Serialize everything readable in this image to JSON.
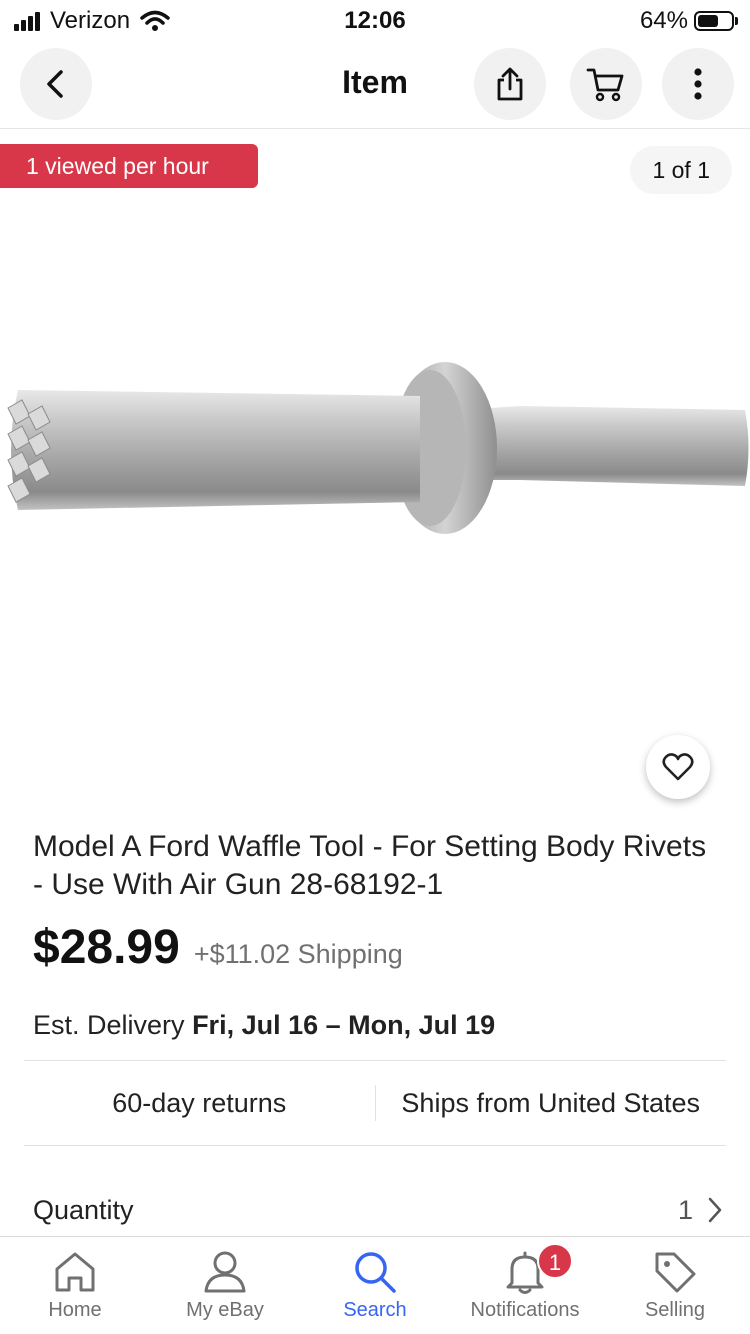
{
  "status_bar": {
    "carrier": "Verizon",
    "time": "12:06",
    "battery": "64%",
    "battery_level": 0.64
  },
  "nav": {
    "title": "Item",
    "icons": [
      "back-icon",
      "share-icon",
      "cart-icon",
      "more-icon"
    ]
  },
  "gallery": {
    "views_badge": "1 viewed per hour",
    "counter": "1 of 1"
  },
  "item": {
    "title": "Model A Ford Waffle Tool - For Setting Body Rivets - Use With Air Gun 28-68192-1",
    "price": "$28.99",
    "shipping": "+$11.02 Shipping",
    "delivery_label": "Est. Delivery",
    "delivery_dates": "Fri, Jul 16 – Mon, Jul 19",
    "returns": "60-day returns",
    "ships_from": "Ships from United States",
    "quantity_label": "Quantity",
    "quantity_value": "1"
  },
  "tabbar": {
    "items": [
      {
        "label": "Home",
        "icon": "home-icon"
      },
      {
        "label": "My eBay",
        "icon": "person-icon"
      },
      {
        "label": "Search",
        "icon": "search-icon"
      },
      {
        "label": "Notifications",
        "icon": "bell-icon"
      },
      {
        "label": "Selling",
        "icon": "tag-icon"
      }
    ],
    "active": "Search",
    "notifications_count": "1"
  },
  "colors": {
    "accent": "#3665f3",
    "badge_red": "#d8374a",
    "muted_text": "#707070"
  }
}
